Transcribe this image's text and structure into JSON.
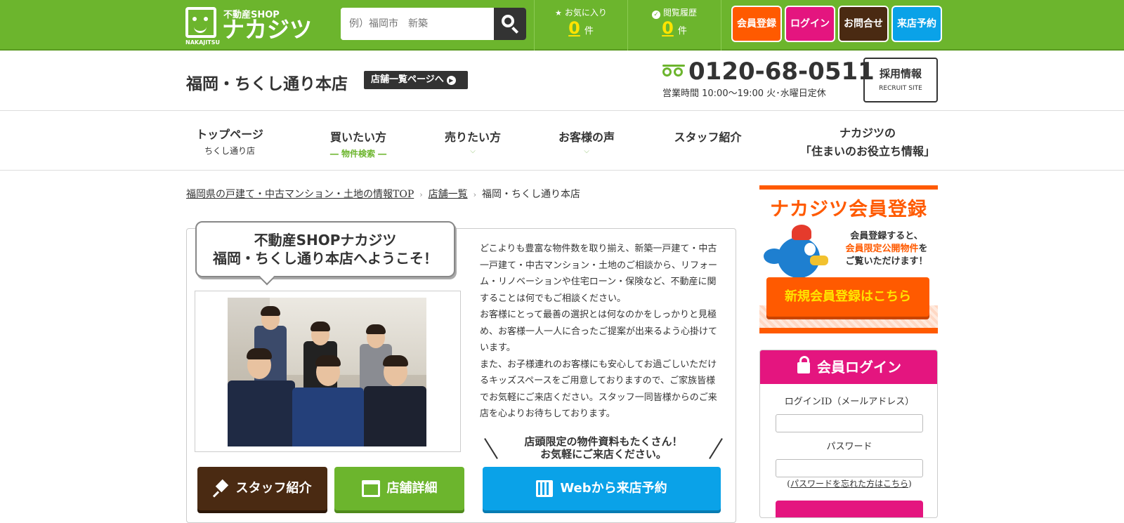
{
  "header": {
    "logo_sub": "不動産SHOP",
    "logo_main": "ナカジツ",
    "logo_en": "NAKAJITSU",
    "search_placeholder": "例）福岡市　新築",
    "favorites": {
      "label": "お気に入り",
      "count": "0",
      "unit": "件"
    },
    "history": {
      "label": "閲覧履歴",
      "count": "0",
      "unit": "件"
    },
    "buttons": [
      {
        "label": "会員登録",
        "color": "#ff5a00"
      },
      {
        "label": "ログイン",
        "color": "#e4157f"
      },
      {
        "label": "お問合せ",
        "color": "#4a2a12"
      },
      {
        "label": "来店予約",
        "color": "#0aa2e8"
      }
    ]
  },
  "shop": {
    "name": "福岡・ちくし通り本店",
    "list_button": "店舗一覧ページへ",
    "phone": "0120-68-0511",
    "hours": "営業時間 10:00～19:00 火･水曜日定休",
    "recruit_title": "採用情報",
    "recruit_sub": "RECRUIT SITE"
  },
  "nav": [
    {
      "label": "トップページ",
      "sub": "ちくし通り店"
    },
    {
      "label": "買いたい方",
      "sub": "― 物件検索 ―"
    },
    {
      "label": "売りたい方",
      "sub": "⌵"
    },
    {
      "label": "お客様の声",
      "sub": "⌵"
    },
    {
      "label": "スタッフ紹介",
      "sub": ""
    },
    {
      "label": "ナカジツの",
      "sub": "「住まいのお役立ち情報」"
    }
  ],
  "breadcrumb": [
    "福岡県の戸建て・中古マンション・土地の情報TOP",
    "店舗一覧",
    "福岡・ちくし通り本店"
  ],
  "welcome": {
    "line1": "不動産SHOPナカジツ",
    "line2": "福岡・ちくし通り本店へようこそ！"
  },
  "description": [
    "どこよりも豊富な物件数を取り揃え、新築一戸建て・中古一戸建て・中古マンション・土地のご相談から、リフォーム・リノベーションや住宅ローン・保険など、不動産に関することは何でもご相談ください。",
    "お客様にとって最善の選択とは何なのかをしっかりと見極め、お客様一人一人に合ったご提案が出来るよう心掛けています。",
    "また、お子様連れのお客様にも安心してお過ごしいただけるキッズスペースをご用意しておりますので、ご家族皆様でお気軽にご来店ください。スタッフ一同皆様からのご来店を心よりお待ちしております。"
  ],
  "notice": {
    "line1": "店頭限定の物件資料もたくさん！",
    "line2": "お気軽にご来店ください。"
  },
  "action_buttons": [
    {
      "label": "スタッフ紹介",
      "color": "#4a2a12"
    },
    {
      "label": "店舗詳細",
      "color": "#6cb52d"
    },
    {
      "label": "Webから来店予約",
      "color": "#0aa2e8"
    }
  ],
  "register_banner": {
    "title": "ナカジツ会員登録",
    "text1": "会員登録すると、",
    "text_highlight": "会員限定公開物件",
    "text2": "を",
    "text3": "ご覧いただけます！",
    "button": "新規会員登録はこちら"
  },
  "login": {
    "title": "会員ログイン",
    "id_label": "ログインID（メールアドレス）",
    "pw_label": "パスワード",
    "forgot_prefix": "(",
    "forgot_link": "パスワードを忘れた方はこちら",
    "forgot_suffix": ")"
  }
}
